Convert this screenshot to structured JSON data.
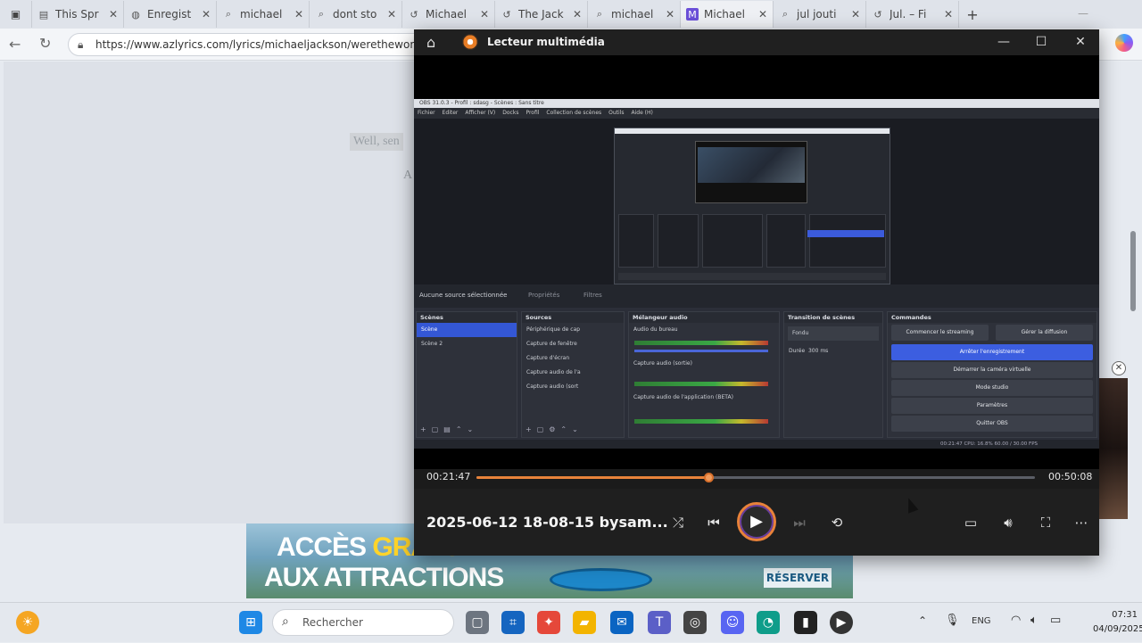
{
  "browser": {
    "tabs": [
      {
        "title": "This Spr",
        "icon": "document-icon"
      },
      {
        "title": "Enregist",
        "icon": "globe-icon"
      },
      {
        "title": "michael",
        "icon": "search-icon"
      },
      {
        "title": "dont sto",
        "icon": "search-icon"
      },
      {
        "title": "Michael",
        "icon": "history-icon"
      },
      {
        "title": "The Jack",
        "icon": "history-icon"
      },
      {
        "title": "michael",
        "icon": "search-icon"
      },
      {
        "title": "Michael",
        "icon": "m-app-icon"
      },
      {
        "title": "jul jouti",
        "icon": "search-icon"
      },
      {
        "title": "Jul. – Fi",
        "icon": "history-icon"
      }
    ],
    "url": "https://www.azlyrics.com/lyrics/michaeljackson/werethewor"
  },
  "page": {
    "lyric_line_1": "Well, sen",
    "lyric_line_2": "A",
    "ad": {
      "line1_prefix": "ACCÈS ",
      "line1_highlight": "GRATUIT",
      "line2": "AUX ATTRACTIONS",
      "button": "RÉSERVER"
    }
  },
  "player": {
    "app_title": "Lecteur multimédia",
    "current_time": "00:21:47",
    "duration": "00:50:08",
    "progress": 0.415,
    "file_title": "2025-06-12 18-08-15 bysam...",
    "obs": {
      "window_title": "OBS 31.0.3 - Profil : sdasg - Scènes : Sans titre",
      "menu": [
        "Fichier",
        "Editer",
        "Afficher (V)",
        "Docks",
        "Profil",
        "Collection de scènes",
        "Outils",
        "Aide (H)"
      ],
      "scene_label": "Aucune source sélectionnée",
      "props_label": "Propriétés",
      "filters_label": "Filtres",
      "docks": {
        "scenes": {
          "title": "Scènes",
          "items": [
            "Scène",
            "Scène 2"
          ]
        },
        "sources": {
          "title": "Sources",
          "items": [
            "Périphérique de cap",
            "Capture de fenêtre",
            "Capture d'écran",
            "Capture audio de l'a",
            "Capture audio (sort"
          ]
        },
        "mixer": {
          "title": "Mélangeur audio",
          "tracks": [
            "Audio du bureau",
            "Capture audio (sortie)",
            "Capture audio de l'application (BETA)"
          ]
        },
        "transitions": {
          "title": "Transition de scènes",
          "type": "Fondu",
          "duration_label": "Durée",
          "duration": "300 ms"
        },
        "controls": {
          "title": "Commandes",
          "buttons": [
            "Commencer le streaming",
            "Gérer la diffusion",
            "Arrêter l'enregistrement",
            "Démarrer la caméra virtuelle",
            "Mode studio",
            "Paramètres",
            "Quitter OBS"
          ]
        }
      },
      "status": "00:21:47   CPU: 16.8%   60.00 / 30.00 FPS"
    }
  },
  "taskbar": {
    "search_placeholder": "Rechercher",
    "lang": "ENG",
    "time": "07:31",
    "date": "04/09/2025"
  },
  "colors": {
    "accent": "#e8823a",
    "obs_select": "#3457d5",
    "player_bg": "#1b1b1b"
  }
}
